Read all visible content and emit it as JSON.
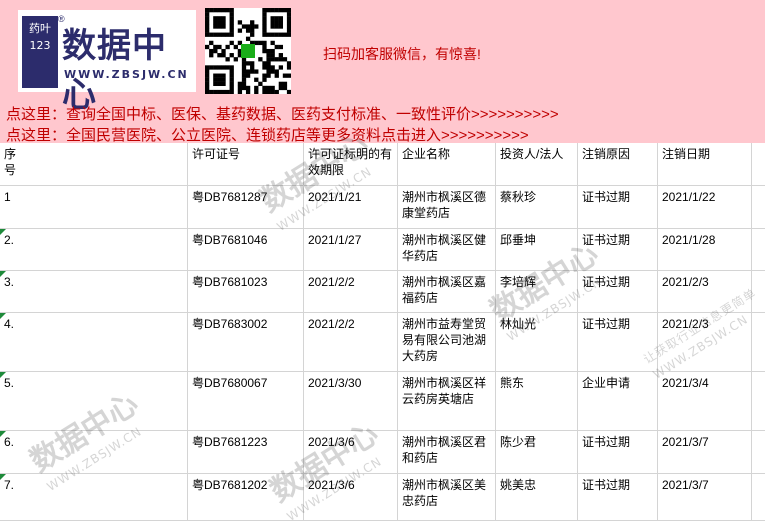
{
  "banner": {
    "logo_mark": "药叶123",
    "logo_reg": "®",
    "logo_title": "数据中心",
    "logo_site": "WWW.ZBSJW.CN",
    "promo": "扫码加客服微信，有惊喜!",
    "link1": "点这里：查询全国中标、医保、基药数据、医药支付标准、一致性评价>>>>>>>>>>",
    "link2": "点这里：全国民营医院、公立医院、连锁药店等更多资料点击进入>>>>>>>>>>"
  },
  "table": {
    "headers": [
      "序\n号",
      "许可证号",
      "许可证标明的有效期限",
      "企业名称",
      "投资人/法人",
      "注销原因",
      "注销日期"
    ],
    "rows": [
      [
        "1",
        "粤DB7681287",
        "2021/1/21",
        "潮州市枫溪区德康堂药店",
        "蔡秋珍",
        "证书过期",
        "2021/1/22"
      ],
      [
        "2.",
        "粤DB7681046",
        "2021/1/27",
        "潮州市枫溪区健华药店",
        "邱垂坤",
        "证书过期",
        "2021/1/28"
      ],
      [
        "3.",
        "粤DB7681023",
        "2021/2/2",
        "潮州市枫溪区嘉福药店",
        "李培辉",
        "证书过期",
        "2021/2/3"
      ],
      [
        "4.",
        "粤DB7683002",
        "2021/2/2",
        "潮州市益寿堂贸易有限公司池湖大药房",
        "林灿光",
        "证书过期",
        "2021/2/3"
      ],
      [
        "5.",
        "粤DB7680067",
        "2021/3/30",
        "潮州市枫溪区祥云药房英塘店",
        "熊东",
        "企业申请",
        "2021/3/4"
      ],
      [
        "6.",
        "粤DB7681223",
        "2021/3/6",
        "潮州市枫溪区君和药店",
        "陈少君",
        "证书过期",
        "2021/3/7"
      ],
      [
        "7.",
        "粤DB7681202",
        "2021/3/6",
        "潮州市枫溪区美忠药店",
        "姚美忠",
        "证书过期",
        "2021/3/7"
      ]
    ]
  },
  "watermark": {
    "title": "数据中心",
    "site": "WWW.ZBSJW.CN",
    "slogan": "让获取行业信息更简单"
  },
  "colors": {
    "banner_bg": "#ffc7ce",
    "link_red": "#c00000",
    "logo_navy": "#2c2c6c",
    "grid": "#d4d4d4",
    "error_flag": "#1e8a3a"
  }
}
